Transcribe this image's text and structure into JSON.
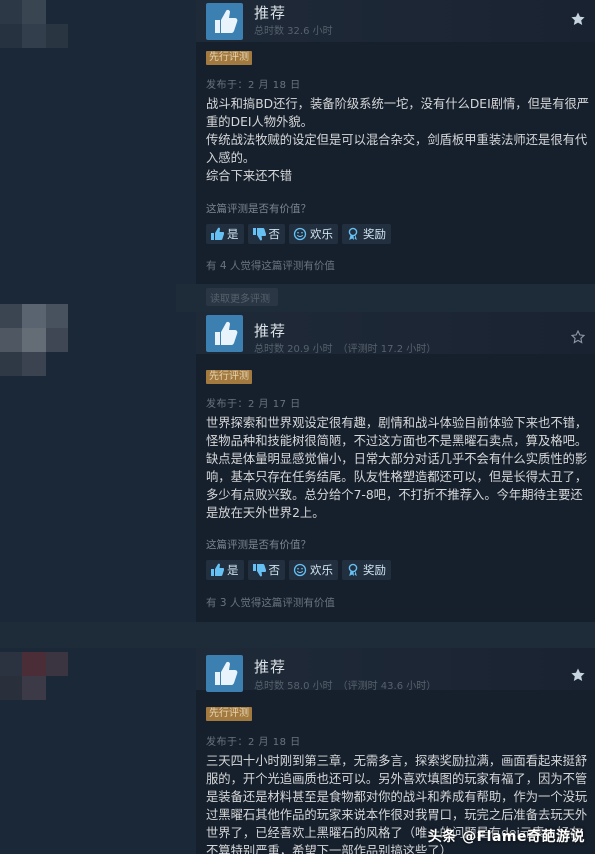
{
  "reviews": [
    {
      "title": "推荐",
      "hours": "总时数 32.6 小时",
      "badge": "先行评测",
      "posted": "发布于：2 月 18 日",
      "paragraphs": [
        "战斗和搞BD还行，装备阶级系统一坨，没有什么DEI剧情，但是有很严重的DEI人物外貌。",
        "传统战法牧贼的设定但是可以混合杂交，剑盾板甲重装法师还是很有代入感的。",
        "综合下来还不错"
      ],
      "helpful_question": "这篇评测是否有价值？",
      "buttons": {
        "yes": "是",
        "no": "否",
        "funny": "欢乐",
        "award": "奖励"
      },
      "found_helpful": "有 4 人觉得这篇评测有价值"
    },
    {
      "title": "推荐",
      "hours": "总时数 20.9 小时　（评测时 17.2 小时）",
      "badge": "先行评测",
      "posted": "发布于：2 月 17 日",
      "paragraphs": [
        "世界探索和世界观设定很有趣，剧情和战斗体验目前体验下来也不错，怪物品种和技能树很简陋，不过这方面也不是黑曜石卖点，算及格吧。缺点是体量明显感觉偏小，日常大部分对话几乎不会有什么实质性的影响，基本只存在任务结尾。队友性格塑造都还可以，但是长得太丑了，多少有点败兴致。总分给个7-8吧，不打折不推荐入。今年期待主要还是放在天外世界2上。"
      ],
      "helpful_question": "这篇评测是否有价值？",
      "buttons": {
        "yes": "是",
        "no": "否",
        "funny": "欢乐",
        "award": "奖励"
      },
      "found_helpful": "有 3 人觉得这篇评测有价值"
    },
    {
      "title": "推荐",
      "hours": "总时数 58.0 小时　（评测时 43.6 小时）",
      "badge": "先行评测",
      "posted": "发布于：2 月 18 日",
      "paragraphs": [
        "三天四十小时刚到第三章，无需多言，探索奖励拉满，画面看起来挺舒服的，开个光追画质也还可以。另外喜欢填图的玩家有福了，因为不管是装备还是材料甚至是食物都对你的战斗和养成有帮助，作为一个没玩过黑曜石其他作品的玩家来说本作很对我胃口，玩完之后准备去玩天外世界了，已经喜欢上黑曜石的风格了（唯一的问题是有dei元素，好在不算特别严重，希望下一部作品别搞这些了）"
      ]
    }
  ],
  "divider_label": "读取更多评测",
  "watermark": "头条 @Flame奇葩游说",
  "colors": {
    "accent": "#66c0f4",
    "badge": "#a27a40",
    "background": "#1b2838"
  }
}
